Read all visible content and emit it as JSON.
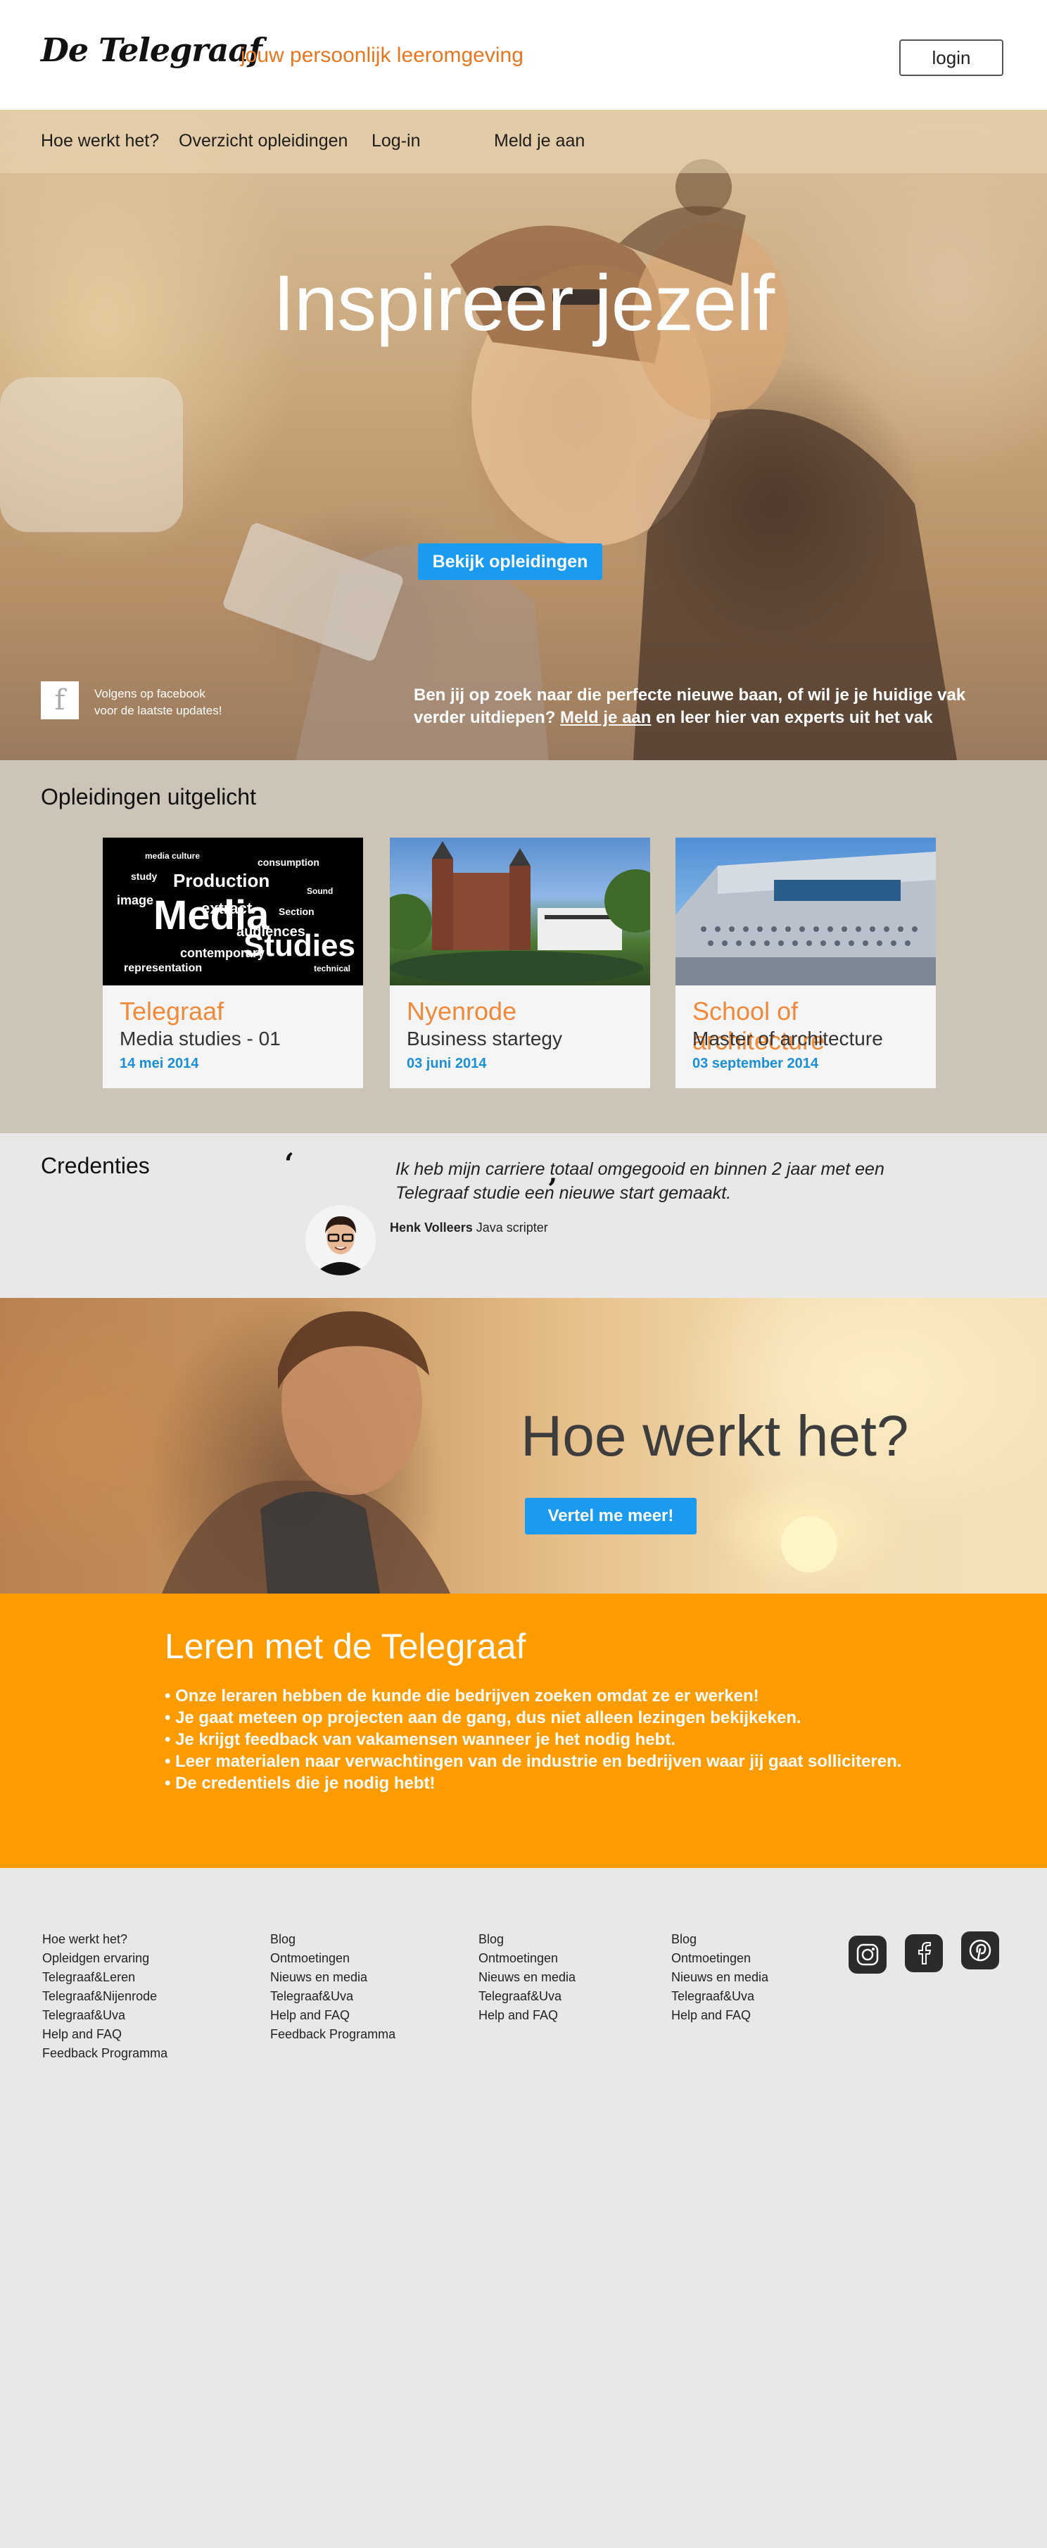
{
  "header": {
    "logo": "De Telegraaf",
    "tagline": "jouw persoonlijk leeromgeving",
    "login_label": "login"
  },
  "nav": {
    "items": [
      {
        "label": "Hoe werkt het?"
      },
      {
        "label": "Overzicht opleidingen"
      },
      {
        "label": "Log-in"
      },
      {
        "label": "Meld je aan"
      }
    ]
  },
  "hero": {
    "title": "Inspireer jezelf",
    "cta_label": "Bekijk opleidingen",
    "facebook_line1": "Volgens op facebook",
    "facebook_line2": "voor de laatste updates!",
    "promo_before": "Ben jij op zoek naar die perfecte nieuwe baan, of wil je je huidige vak verder uitdiepen? ",
    "promo_link": "Meld je aan",
    "promo_after": " en leer hier van experts uit het vak"
  },
  "featured": {
    "title": "Opleidingen uitgelicht",
    "cards": [
      {
        "brand": "Telegraaf",
        "course": "Media studies - 01",
        "date": "14 mei 2014",
        "image": "media-wordcloud-image"
      },
      {
        "brand": "Nyenrode",
        "course": "Business startegy",
        "date": "03 juni 2014",
        "image": "castle-image"
      },
      {
        "brand": "School of architecture",
        "course": "Master of architecture",
        "date": "03 september 2014",
        "image": "building-image"
      }
    ]
  },
  "credentials": {
    "title": "Credenties",
    "quote": "Ik heb mijn carriere totaal omgegooid en binnen 2 jaar met een Telegraaf studie een nieuwe start gemaakt.",
    "person_name": "Henk Volleers",
    "person_role": "Java scripter"
  },
  "how": {
    "title": "Hoe werkt het?",
    "cta_label": "Vertel me meer!"
  },
  "learn": {
    "title": "Leren met de Telegraaf",
    "items": [
      "• Onze leraren hebben de kunde die bedrijven zoeken omdat ze er werken!",
      "• Je gaat meteen op projecten aan de gang, dus niet alleen lezingen bekijkeken.",
      "• Je krijgt feedback van vakamensen wanneer je het nodig hebt.",
      "• Leer materialen naar verwachtingen van de industrie en bedrijven waar jij gaat solliciteren.",
      "• De credentiels die je nodig hebt!"
    ]
  },
  "footer": {
    "columns": [
      [
        "Hoe werkt het?",
        "Opleidgen ervaring",
        "Telegraaf&Leren",
        "Telegraaf&Nijenrode",
        "Telegraaf&Uva",
        "Help and FAQ",
        "Feedback Programma"
      ],
      [
        "Blog",
        "Ontmoetingen",
        "Nieuws en media",
        "Telegraaf&Uva",
        "Help and FAQ",
        "Feedback Programma"
      ],
      [
        "Blog",
        "Ontmoetingen",
        "Nieuws en media",
        "Telegraaf&Uva",
        "Help and FAQ"
      ],
      [
        "Blog",
        "Ontmoetingen",
        "Nieuws en media",
        "Telegraaf&Uva",
        "Help and FAQ"
      ]
    ],
    "social": [
      "instagram-icon",
      "facebook-icon",
      "pinterest-icon"
    ]
  },
  "colors": {
    "accent_orange": "#fd9c00",
    "tagline_orange": "#e8761f",
    "button_blue": "#1a9bf0",
    "date_blue": "#1a8fd6"
  }
}
